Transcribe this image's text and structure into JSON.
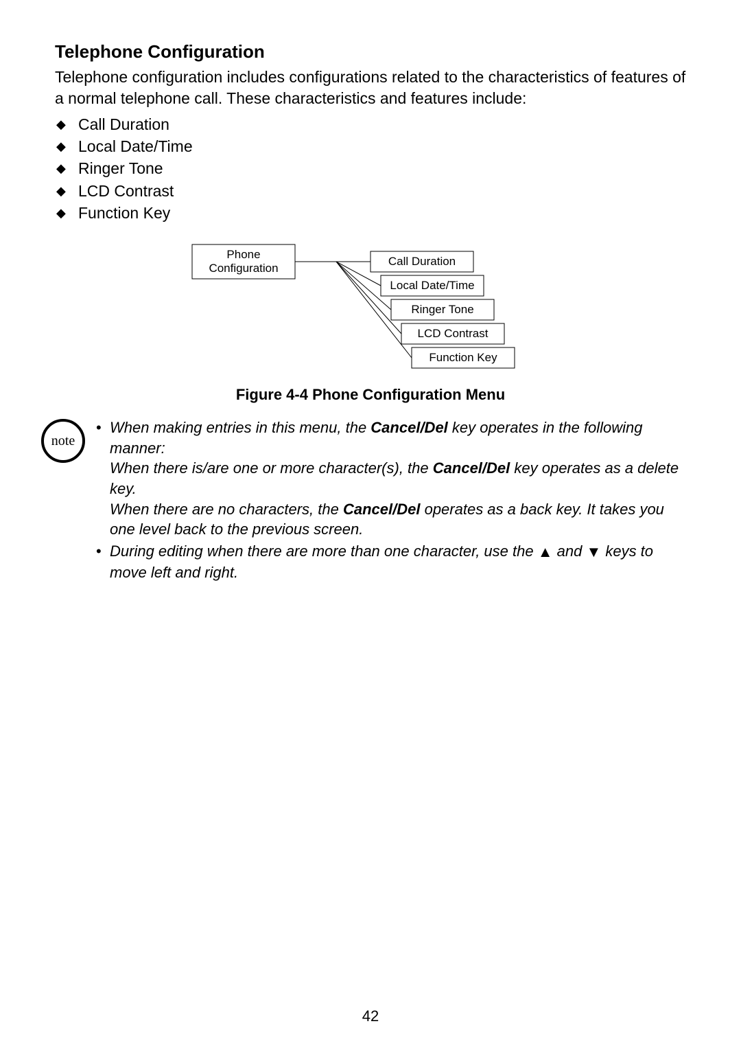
{
  "section_title": "Telephone Configuration",
  "intro": "Telephone configuration includes configurations related to the characteristics of features of a normal telephone call. These characteristics and features include:",
  "bullets": [
    "Call Duration",
    "Local Date/Time",
    "Ringer Tone",
    "LCD Contrast",
    "Function Key"
  ],
  "diagram": {
    "root_line1": "Phone",
    "root_line2": "Configuration",
    "items": [
      "Call Duration",
      "Local Date/Time",
      "Ringer Tone",
      "LCD Contrast",
      "Function Key"
    ]
  },
  "figure_caption": "Figure 4-4 Phone Configuration Menu",
  "note_label": "note",
  "note_items": {
    "i1_a": "When making entries in this menu, the ",
    "i1_b": "Cancel/Del",
    "i1_c": " key operates in the following manner:",
    "i1_d": "When there is/are one or more character(s), the ",
    "i1_e": "Cancel/Del",
    "i1_f": " key operates as a delete key.",
    "i1_g": "When there are no characters, the ",
    "i1_h": "Cancel/Del",
    "i1_i": " operates as a back key. It takes you one level back to the previous screen.",
    "i2_a": "During editing when there are more than one character, use the ",
    "i2_b": " and ",
    "i2_c": " keys to move left and right."
  },
  "triangle_up": "▲",
  "triangle_down": "▼",
  "page_number": "42"
}
